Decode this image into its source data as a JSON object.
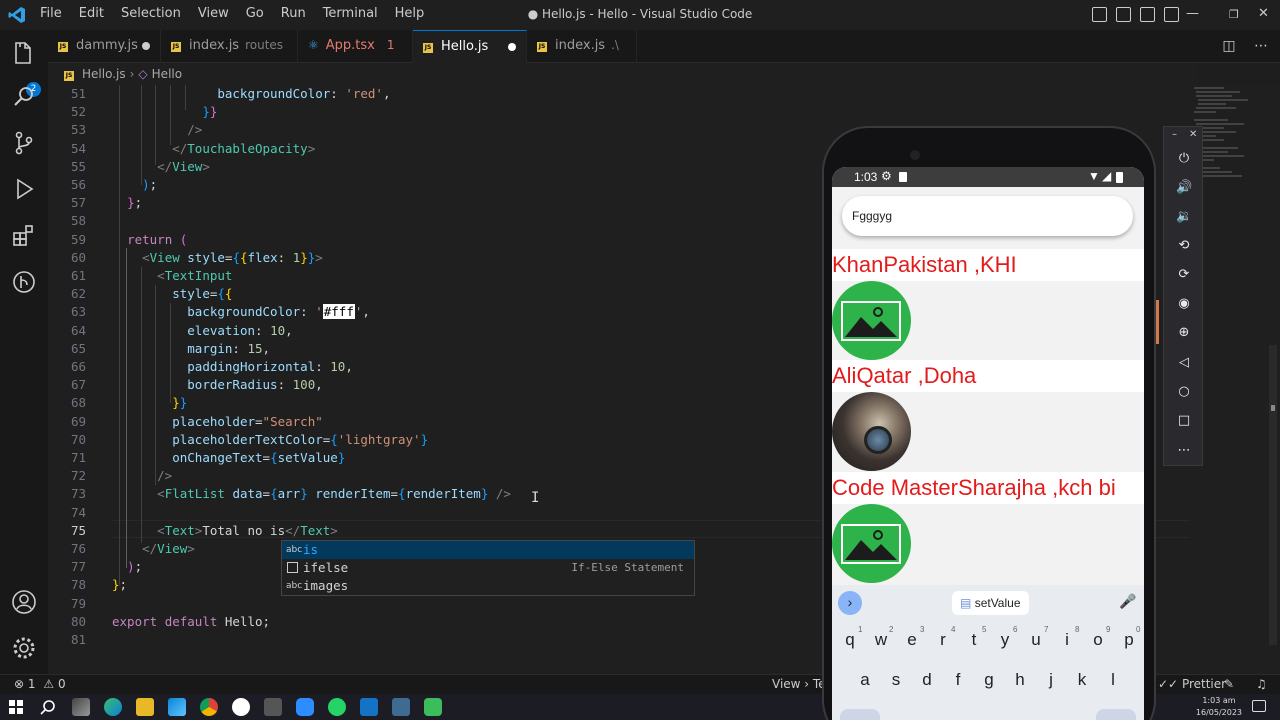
{
  "window": {
    "title": "● Hello.js - Hello - Visual Studio Code",
    "menu": [
      "File",
      "Edit",
      "Selection",
      "View",
      "Go",
      "Run",
      "Terminal",
      "Help"
    ]
  },
  "activity": {
    "source_control_badge": "2"
  },
  "tabs": [
    {
      "label": "dammy.js",
      "desc": "",
      "dirty": true
    },
    {
      "label": "index.js",
      "desc": "routes"
    },
    {
      "label": "App.tsx",
      "desc": "",
      "count": "1"
    },
    {
      "label": "Hello.js",
      "desc": "",
      "dirty": true,
      "active": true
    },
    {
      "label": "index.js",
      "desc": ".\\"
    }
  ],
  "breadcrumb": {
    "file": "Hello.js",
    "symbol": "Hello"
  },
  "editor": {
    "line_numbers": [
      "51",
      "52",
      "53",
      "54",
      "55",
      "56",
      "57",
      "58",
      "59",
      "60",
      "61",
      "62",
      "63",
      "64",
      "65",
      "66",
      "67",
      "68",
      "69",
      "70",
      "71",
      "72",
      "73",
      "74",
      "75",
      "76",
      "77",
      "78",
      "79",
      "80",
      "81"
    ],
    "current_line": "75",
    "highlight_value": "#fff"
  },
  "suggest": [
    {
      "kind": "abc",
      "label": "is",
      "match": "is",
      "detail": ""
    },
    {
      "kind": "snippet",
      "label": "ifelse",
      "match": "",
      "detail": "If-Else Statement"
    },
    {
      "kind": "abc",
      "label": "images",
      "match": "",
      "detail": ""
    }
  ],
  "status": {
    "errors": "1",
    "warnings": "0",
    "right_text": "View › Te",
    "prettier": "Prettier"
  },
  "taskbar": {
    "time": "1:03 am",
    "date": "16/05/2023"
  },
  "phone": {
    "time": "1:03",
    "search_value": "Fgggyg",
    "items": [
      {
        "title": "KhanPakistan ,KHI",
        "image": "placeholder"
      },
      {
        "title": "AliQatar ,Doha",
        "image": "photo"
      },
      {
        "title": "Code MasterSharajha ,kch bi",
        "image": "placeholder"
      }
    ],
    "keyboard": {
      "suggestion": "setValue",
      "row1": [
        "q",
        "w",
        "e",
        "r",
        "t",
        "y",
        "u",
        "i",
        "o",
        "p"
      ],
      "row1_hints": [
        "1",
        "2",
        "3",
        "4",
        "5",
        "6",
        "7",
        "8",
        "9",
        "0"
      ],
      "row2": [
        "a",
        "s",
        "d",
        "f",
        "g",
        "h",
        "j",
        "k",
        "l"
      ]
    }
  },
  "colors": {
    "accent": "#0078d4",
    "error_text": "#e31b1b",
    "image_green": "#2db34a"
  }
}
